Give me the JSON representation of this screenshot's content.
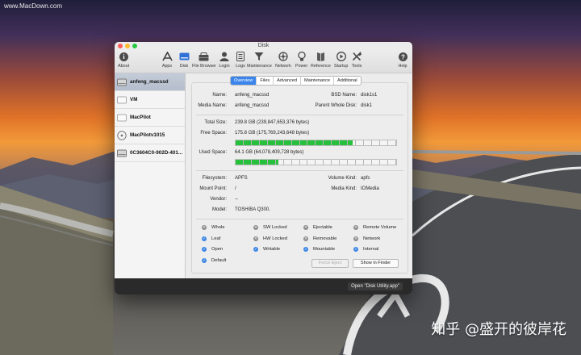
{
  "watermark_top": "www.MacDown.com",
  "watermark_bottom": "知乎 @盛开的彼岸花",
  "window": {
    "title": "Disk",
    "traffic_lights": [
      "#fd5f57",
      "#febc2e",
      "#28c840"
    ]
  },
  "toolbar": {
    "items": [
      {
        "label": "About",
        "icon": "info-icon"
      },
      {
        "label": "Apps",
        "icon": "apps-icon"
      },
      {
        "label": "Disk",
        "icon": "disk-icon"
      },
      {
        "label": "File Browser",
        "icon": "file-browser-icon"
      },
      {
        "label": "Login",
        "icon": "login-icon"
      },
      {
        "label": "Logs",
        "icon": "logs-icon"
      },
      {
        "label": "Maintenance",
        "icon": "maintenance-icon"
      },
      {
        "label": "Network",
        "icon": "network-icon"
      },
      {
        "label": "Power",
        "icon": "power-icon"
      },
      {
        "label": "Reference",
        "icon": "reference-icon"
      },
      {
        "label": "Startup",
        "icon": "startup-icon"
      },
      {
        "label": "Tools",
        "icon": "tools-icon"
      },
      {
        "label": "Help",
        "icon": "help-icon"
      }
    ]
  },
  "sidebar": {
    "items": [
      {
        "label": "anfeng_macssd",
        "selected": true
      },
      {
        "label": "VM",
        "selected": false
      },
      {
        "label": "MacPilot",
        "selected": false
      },
      {
        "label": "MacPilotv1015",
        "selected": false
      },
      {
        "label": "0C3604C0-902D-401...",
        "selected": false
      }
    ]
  },
  "tabs": [
    {
      "label": "Overview",
      "active": true
    },
    {
      "label": "Files",
      "active": false
    },
    {
      "label": "Advanced",
      "active": false
    },
    {
      "label": "Maintenance",
      "active": false
    },
    {
      "label": "Additional",
      "active": false
    }
  ],
  "overview": {
    "name_label": "Name:",
    "name": "anfeng_macssd",
    "media_name_label": "Media Name:",
    "media_name": "anfeng_macssd",
    "bsd_name_label": "BSD Name:",
    "bsd_name": "disk1s1",
    "parent_label": "Parent Whole Disk:",
    "parent": "disk1",
    "total_size_label": "Total Size:",
    "total_size": "239.8 GB (239,847,653,376 bytes)",
    "free_space_label": "Free Space:",
    "free_space": "175.8 GB (175,769,243,648 bytes)",
    "free_fraction": 0.733,
    "used_space_label": "Used Space:",
    "used_space": "64.1 GB (64,078,409,728 bytes)",
    "used_fraction": 0.267,
    "filesystem_label": "Filesystem:",
    "filesystem": "APFS",
    "volume_kind_label": "Volume Kind:",
    "volume_kind": "apfs",
    "mount_point_label": "Mount Point:",
    "mount_point": "/",
    "media_kind_label": "Media Kind:",
    "media_kind": "IOMedia",
    "vendor_label": "Vendor:",
    "vendor": "--",
    "model_label": "Model:",
    "model": "TOSHIBA Q300."
  },
  "bar_colors": {
    "green": "#27c03c",
    "empty": "#f4f4f4"
  },
  "flags": [
    {
      "label": "Whole",
      "on": false
    },
    {
      "label": "SW Locked",
      "on": false
    },
    {
      "label": "Ejectable",
      "on": false
    },
    {
      "label": "Remote Volume",
      "on": false
    },
    {
      "label": "Leaf",
      "on": true
    },
    {
      "label": "HW Locked",
      "on": false
    },
    {
      "label": "Removable",
      "on": false
    },
    {
      "label": "Network",
      "on": false
    },
    {
      "label": "Open",
      "on": true
    },
    {
      "label": "Writable",
      "on": true
    },
    {
      "label": "Mountable",
      "on": true
    },
    {
      "label": "Internal",
      "on": true
    },
    {
      "label": "Default",
      "on": true
    }
  ],
  "buttons": {
    "force_eject": "Force Eject",
    "show_in_finder": "Show in Finder",
    "open_disk_utility": "Open \"Disk Utility.app\""
  }
}
